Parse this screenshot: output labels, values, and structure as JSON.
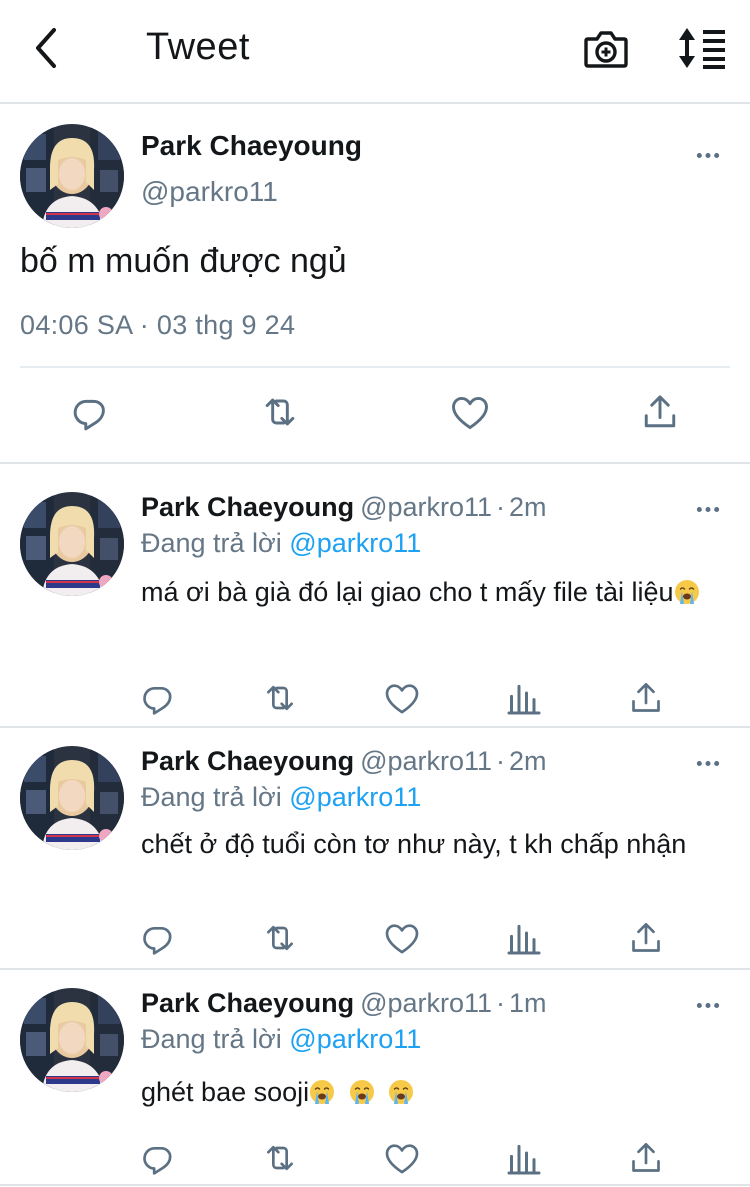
{
  "header": {
    "title": "Tweet",
    "back_icon": "chevron-left-icon",
    "camera_icon": "camera-plus-icon",
    "sort_icon": "sort-icon"
  },
  "main_tweet": {
    "name": "Park Chaeyoung",
    "handle": "@parkro11",
    "text": "bố m muốn được ngủ",
    "timestamp": "04:06 SA · 03 thg 9 24"
  },
  "replies": [
    {
      "name": "Park Chaeyoung",
      "handle": "@parkro11",
      "dot": "·",
      "time": "2m",
      "replying_label": "Đang trả lời",
      "replying_to": "@parkro11",
      "text": "má ơi bà già đó lại giao cho t mấy file tài liệu",
      "emoji_count": 1
    },
    {
      "name": "Park Chaeyoung",
      "handle": "@parkro11",
      "dot": "·",
      "time": "2m",
      "replying_label": "Đang trả lời",
      "replying_to": "@parkro11",
      "text": "chết ở độ tuổi còn tơ như này, t kh chấp nhận",
      "emoji_count": 0
    },
    {
      "name": "Park Chaeyoung",
      "handle": "@parkro11",
      "dot": "·",
      "time": "1m",
      "replying_label": "Đang trả lời",
      "replying_to": "@parkro11",
      "text": "ghét bae sooji",
      "emoji_count": 3
    }
  ],
  "colors": {
    "text": "#14171a",
    "muted": "#657786",
    "link": "#1da1f2",
    "divider": "#e1e4e6",
    "icon": "#5b7083"
  }
}
